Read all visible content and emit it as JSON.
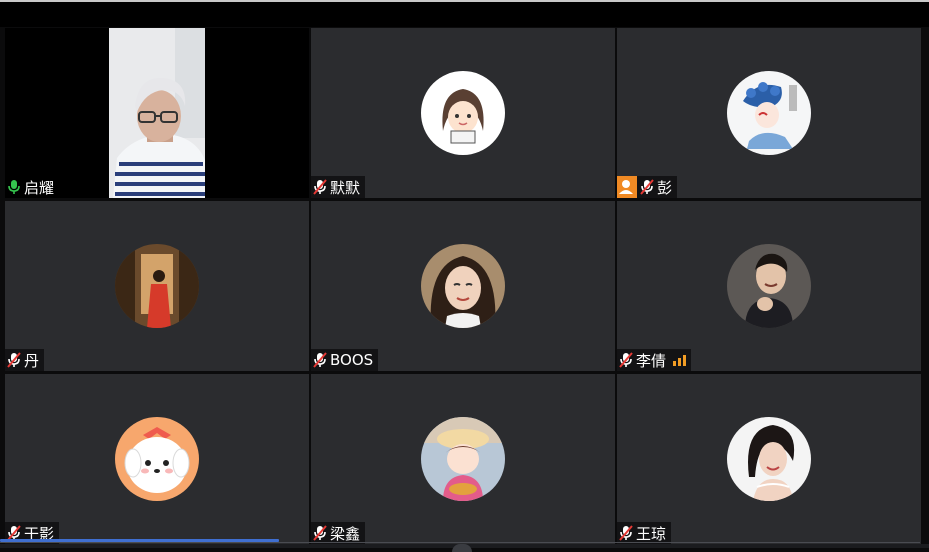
{
  "participants": [
    {
      "name": "启耀",
      "muted": false,
      "video": true
    },
    {
      "name": "默默",
      "muted": true,
      "video": false
    },
    {
      "name": "彭",
      "muted": true,
      "video": false,
      "badge": "person-icon"
    },
    {
      "name": "丹",
      "muted": true,
      "video": false
    },
    {
      "name": "BOOS",
      "muted": true,
      "video": false
    },
    {
      "name": "李倩",
      "muted": true,
      "video": false,
      "signal": "signal-bars-icon"
    },
    {
      "name": "干影",
      "muted": true,
      "video": false
    },
    {
      "name": "梁鑫",
      "muted": true,
      "video": false
    },
    {
      "name": "王琼",
      "muted": true,
      "video": false
    }
  ],
  "colors": {
    "tile_bg": "#2b2c2f",
    "active_speaker_border": "#2f8a3f",
    "badge_orange": "#f08a24",
    "signal_orange": "#f29d25",
    "progress_blue": "#3f6fd1"
  },
  "icons": {
    "mic_on": "mic-icon",
    "mic_off": "mic-muted-icon"
  }
}
